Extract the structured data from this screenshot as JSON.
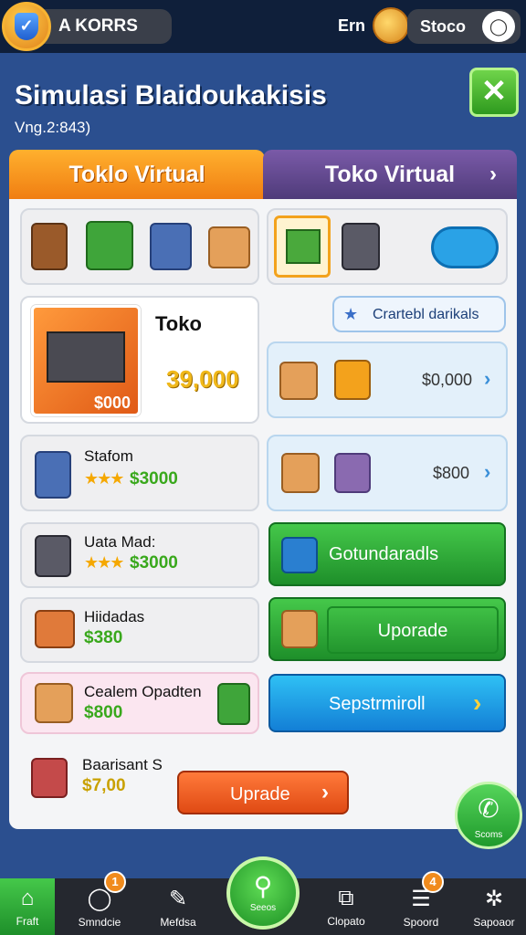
{
  "header": {
    "player_name": "A KORRS",
    "coins_label": "Ern",
    "settings_label": "Stoco",
    "title": "Simulasi Blaidoukakisis",
    "version": "Vng.2:843)"
  },
  "tabs": [
    {
      "label": "Toklo Virtual"
    },
    {
      "label": "Toko Virtual"
    }
  ],
  "featured": {
    "title": "Toko",
    "image_price": "$000",
    "price": "39,000",
    "tag_label": "Crartebl darikals",
    "offer_price": "$0,000"
  },
  "items": [
    {
      "name": "Stafom",
      "price": "$3000",
      "stars": "★★★"
    },
    {
      "name": "Uata Mad:",
      "price": "$3000",
      "stars": "★★★"
    },
    {
      "name": "Hiidadas",
      "price": "$380"
    },
    {
      "name": "Cealem Opadten",
      "price": "$800"
    },
    {
      "name": "Baarisant S",
      "price": "$7,00"
    }
  ],
  "side": {
    "offer2_price": "$800",
    "btn1_label": "Gotundaradls",
    "btn2_label": "Uporade",
    "btn3_label": "Sepstrmiroll",
    "upgrade_label": "Uprade"
  },
  "call_label": "Scoms",
  "nav": [
    {
      "label": "Fraft",
      "icon": "home-icon"
    },
    {
      "label": "Smndcie",
      "icon": "chat-icon",
      "badge": "1"
    },
    {
      "label": "Mefdsa",
      "icon": "tool-icon"
    },
    {
      "label": "Seeos",
      "icon": "search-icon"
    },
    {
      "label": "Clopato",
      "icon": "puzzle-icon"
    },
    {
      "label": "Spoord",
      "icon": "board-icon",
      "badge": "4"
    },
    {
      "label": "Sapoaor",
      "icon": "settings-icon"
    }
  ],
  "colors": {
    "background": "#2b4f8f",
    "tab_active": "#f07e12",
    "tab_inactive": "#4f3b7a",
    "price_green": "#39a81c",
    "price_gold": "#f0b81a"
  }
}
